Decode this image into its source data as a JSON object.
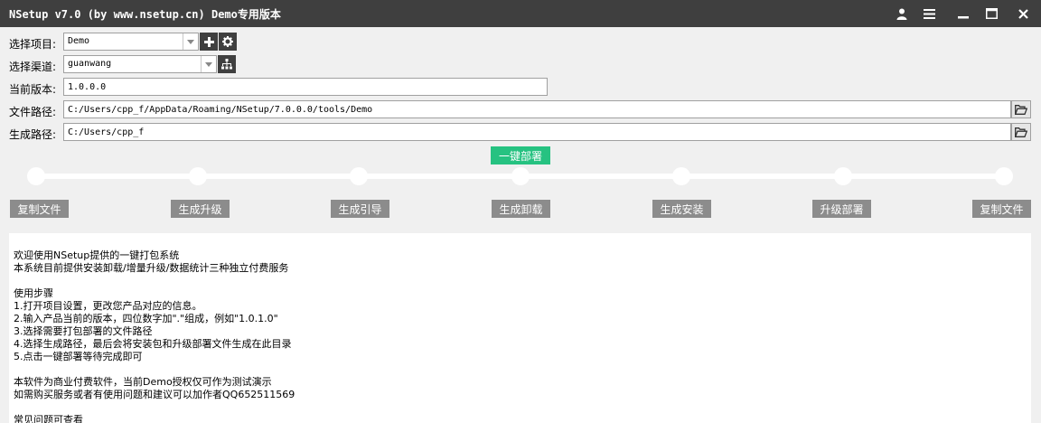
{
  "window": {
    "title": "NSetup v7.0 (by www.nsetup.cn) Demo专用版本",
    "icons": [
      "user-icon",
      "menu-icon",
      "minimize-icon",
      "maximize-icon",
      "close-icon"
    ]
  },
  "form": {
    "project": {
      "label": "选择项目:",
      "value": "Demo"
    },
    "channel": {
      "label": "选择渠道:",
      "value": "guanwang"
    },
    "version": {
      "label": "当前版本:",
      "value": "1.0.0.0"
    },
    "file_path": {
      "label": "文件路径:",
      "value": "C:/Users/cpp_f/AppData/Roaming/NSetup/7.0.0.0/tools/Demo"
    },
    "output_path": {
      "label": "生成路径:",
      "value": "C:/Users/cpp_f"
    }
  },
  "deploy_button": "一键部署",
  "steps": [
    "复制文件",
    "生成升级",
    "生成引导",
    "生成卸载",
    "生成安装",
    "升级部署",
    "复制文件"
  ],
  "log": [
    "欢迎使用NSetup提供的一键打包系统",
    "本系统目前提供安装卸载/增量升级/数据统计三种独立付费服务",
    "",
    "使用步骤",
    "1.打开项目设置，更改您产品对应的信息。",
    "2.输入产品当前的版本，四位数字加\".\"组成，例如\"1.0.1.0\"",
    "3.选择需要打包部署的文件路径",
    "4.选择生成路径，最后会将安装包和升级部署文件生成在此目录",
    "5.点击一键部署等待完成即可",
    "",
    "本软件为商业付费软件，当前Demo授权仅可作为测试演示",
    "如需购买服务或者有使用问题和建议可以加作者QQ652511569",
    "",
    "常见问题可查看"
  ],
  "colors": {
    "titlebar": "#3f3f3f",
    "accent": "#26c281",
    "step_button": "#8c8c8c"
  }
}
